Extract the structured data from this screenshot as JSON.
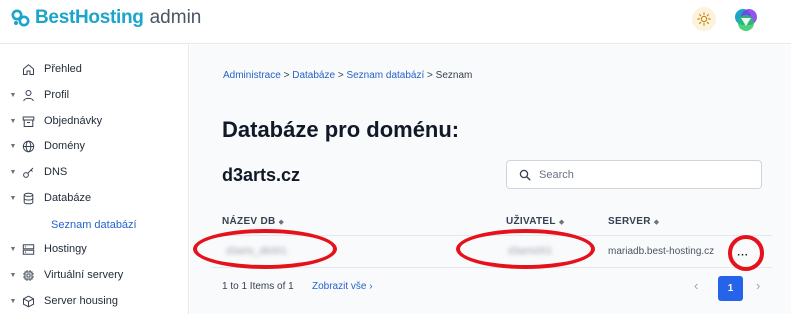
{
  "brand": {
    "name": "BestHosting",
    "sub": "admin"
  },
  "sidebar": {
    "items": [
      {
        "label": "Přehled",
        "icon": "home-icon"
      },
      {
        "label": "Profil",
        "icon": "user-icon"
      },
      {
        "label": "Objednávky",
        "icon": "archive-icon"
      },
      {
        "label": "Domény",
        "icon": "globe-icon"
      },
      {
        "label": "DNS",
        "icon": "key-icon"
      },
      {
        "label": "Databáze",
        "icon": "database-icon"
      },
      {
        "label": "Hostingy",
        "icon": "server-icon"
      },
      {
        "label": "Virtuální servery",
        "icon": "chip-icon"
      },
      {
        "label": "Server housing",
        "icon": "box-icon"
      }
    ],
    "sub_item": "Seznam databází"
  },
  "breadcrumb": {
    "items": [
      "Administrace",
      "Databáze",
      "Seznam databází"
    ],
    "current": "Seznam",
    "separator": ">"
  },
  "page": {
    "title": "Databáze pro doménu:",
    "domain": "d3arts.cz"
  },
  "search": {
    "placeholder": "Search",
    "value": ""
  },
  "table": {
    "columns": [
      "NÁZEV DB",
      "UŽIVATEL",
      "SERVER"
    ],
    "sort_icon": "◆",
    "rows": [
      {
        "name": "d3arts_db001",
        "user": "d3arts001",
        "server": "mariadb.best-hosting.cz",
        "actions": "···"
      }
    ]
  },
  "footer": {
    "count": "1 to 1 Items of 1",
    "show_all": "Zobrazit vše",
    "show_all_arrow": "›"
  },
  "pagination": {
    "prev": "‹",
    "current": "1",
    "next": "›"
  },
  "colors": {
    "brand": "#1aa5c9",
    "link": "#2563c9",
    "primary": "#2563eb",
    "highlight": "#e5121b"
  }
}
